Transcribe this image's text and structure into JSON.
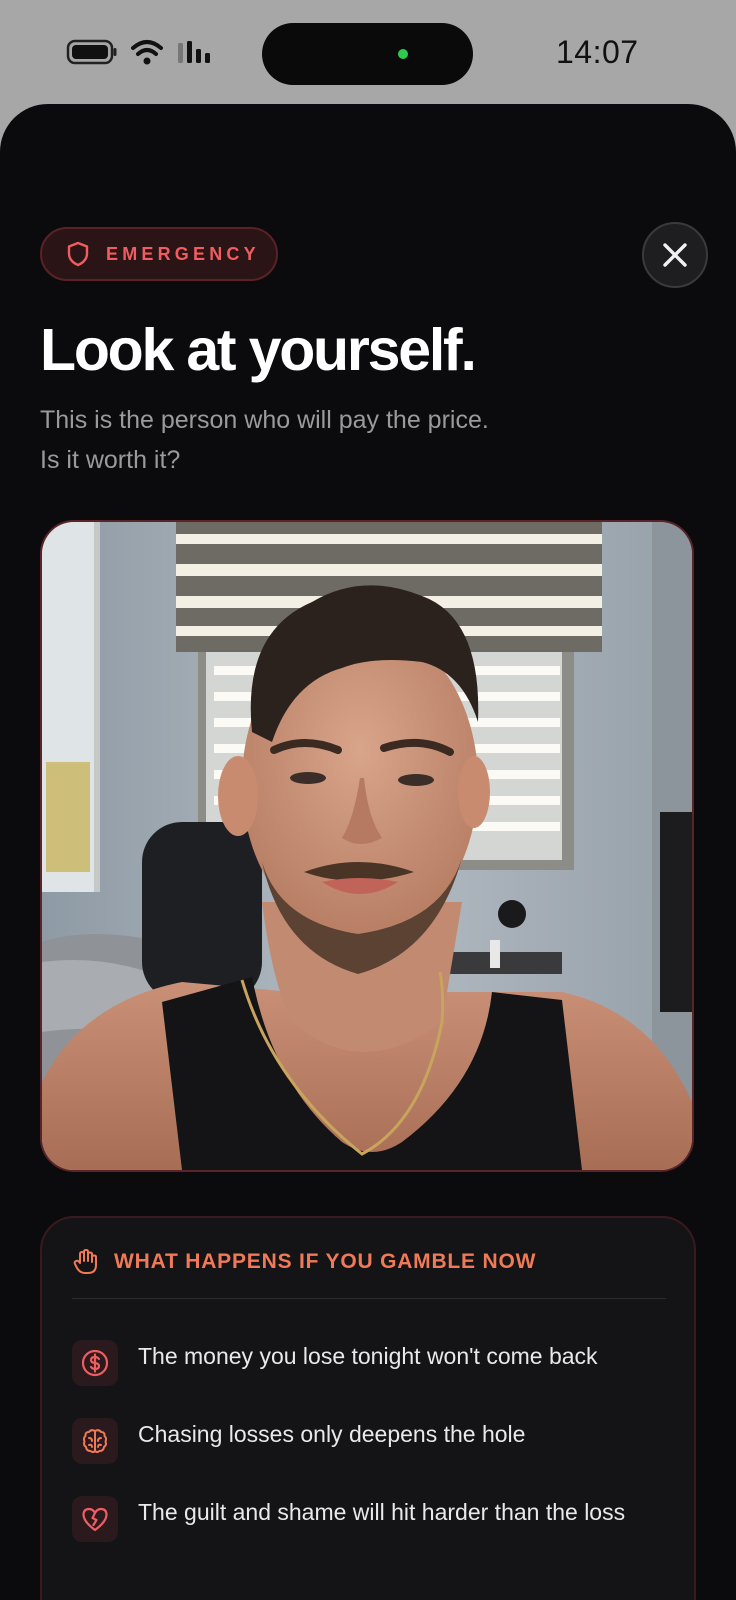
{
  "status_bar": {
    "time": "14:07",
    "icons": [
      "battery-icon",
      "wifi-icon",
      "signal-icon"
    ],
    "camera_indicator_color": "#2ecc4a"
  },
  "badge": {
    "label": "EMERGENCY",
    "icon": "shield-icon",
    "color": "#f05d60"
  },
  "close_button": {
    "icon": "close-icon"
  },
  "title": "Look at yourself.",
  "subtitle": {
    "line1": "This is the person who will pay the price.",
    "line2": "Is it worth it?"
  },
  "photo": {
    "subject": "selfie"
  },
  "consequences_panel": {
    "title": "WHAT HAPPENS IF YOU GAMBLE NOW",
    "icon": "hand-icon",
    "accent": "#f07a58",
    "items": [
      {
        "icon": "dollar-icon",
        "text": "The money you lose tonight won't come back"
      },
      {
        "icon": "brain-icon",
        "text": "Chasing losses only deepens the hole"
      },
      {
        "icon": "broken-heart-icon",
        "text": "The guilt and shame will hit harder than the loss"
      }
    ]
  }
}
